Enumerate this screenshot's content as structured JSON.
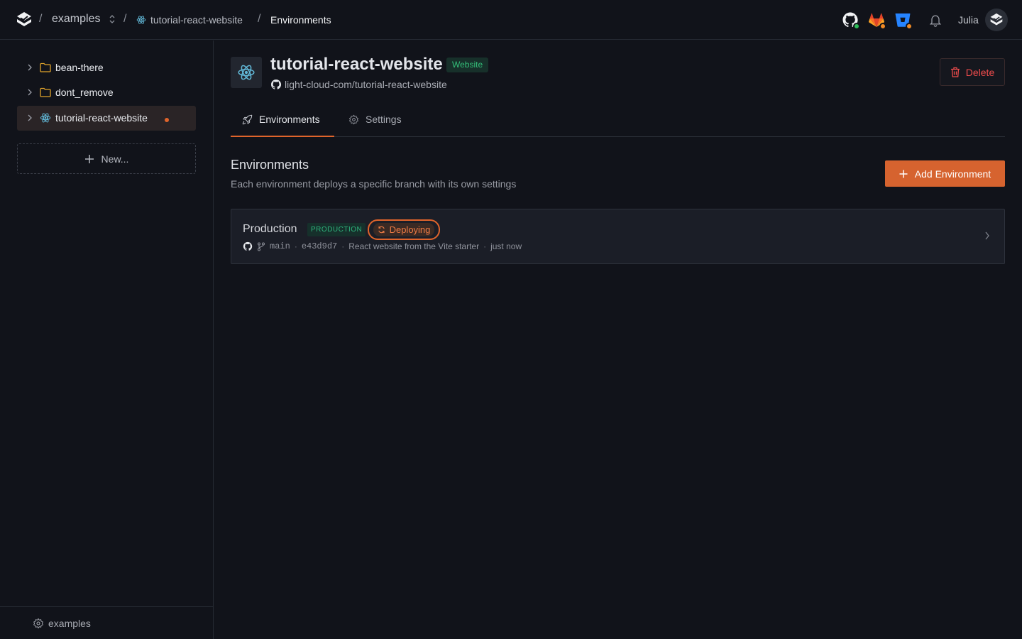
{
  "header": {
    "org": "examples",
    "project": "tutorial-react-website",
    "page": "Environments",
    "user": "Julia",
    "separator": "/",
    "icons": [
      "github-icon",
      "gitlab-icon",
      "bitbucket-icon",
      "bell-icon"
    ],
    "status_colors": {
      "github": "#2ebd59",
      "gitlab": "#f08a24",
      "bitbucket": "#f08a24"
    }
  },
  "sidebar": {
    "items": [
      {
        "label": "bean-there",
        "icon": "folder-icon"
      },
      {
        "label": "dont_remove",
        "icon": "folder-icon"
      },
      {
        "label": "tutorial-react-website",
        "icon": "react-icon",
        "active": true
      }
    ],
    "new_label": "New...",
    "footer_label": "examples"
  },
  "project": {
    "title": "tutorial-react-website",
    "badge": "Website",
    "repo": "light-cloud-com/tutorial-react-website",
    "delete_label": "Delete"
  },
  "tabs": [
    {
      "label": "Environments",
      "icon": "rocket-icon",
      "active": true
    },
    {
      "label": "Settings",
      "icon": "gear-icon",
      "active": false
    }
  ],
  "environments_section": {
    "title": "Environments",
    "subtitle": "Each environment deploys a specific branch with its own settings",
    "add_label": "Add Environment"
  },
  "environment": {
    "name": "Production",
    "badge": "PRODUCTION",
    "status": "Deploying",
    "branch": "main",
    "commit": "e43d9d7",
    "message": "React website from the Vite starter",
    "time": "just now",
    "meta_separator": "·"
  },
  "colors": {
    "accent": "#e0642b",
    "success": "#34c07a",
    "danger": "#ef4c4c",
    "background": "#11131a"
  }
}
